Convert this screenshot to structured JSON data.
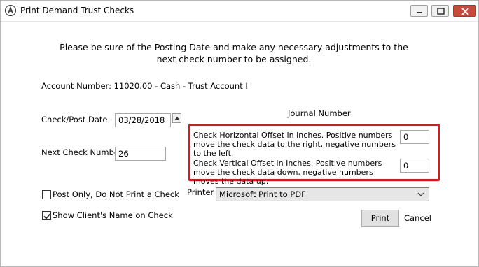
{
  "window": {
    "title": "Print Demand Trust Checks"
  },
  "intro_text": "Please be sure of the Posting Date and make any necessary adjustments to the next check number to be assigned.",
  "account": {
    "text": "Account Number:  11020.00 - Cash - Trust Account I"
  },
  "check_post_date": {
    "label": "Check/Post Date",
    "value": "03/28/2018"
  },
  "next_check": {
    "label": "Next Check Number:",
    "value": "26"
  },
  "journal_label": "Journal Number",
  "horizontal_offset": {
    "text": "Check Horizontal Offset in Inches.  Positive numbers move the check data to the right, negative numbers to the left.",
    "value": "0"
  },
  "vertical_offset": {
    "text": "Check Vertical Offset in Inches.  Positive numbers move the check data down, negative numbers moves the data up.",
    "value": "0"
  },
  "post_only": {
    "label": "Post Only, Do Not Print a Check",
    "checked": false
  },
  "show_client_name": {
    "label": "Show Client's Name on Check",
    "checked": true
  },
  "printer": {
    "label": "Printer",
    "selected": "Microsoft Print to PDF"
  },
  "buttons": {
    "print": "Print",
    "cancel": "Cancel"
  },
  "colors": {
    "highlight": "#e0161d",
    "close_button": "#c74a3a"
  }
}
